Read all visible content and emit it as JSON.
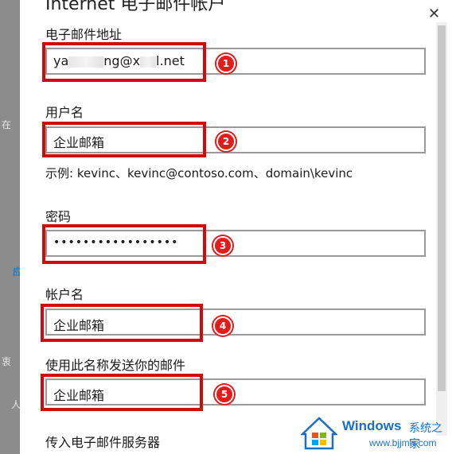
{
  "dialog": {
    "title": "Internet 电子邮件帐户",
    "close_glyph": "✕"
  },
  "background_fragments": {
    "frag1": "在",
    "frag2": "应",
    "frag3": "衷",
    "frag4": "人"
  },
  "form": {
    "email_label": "电子邮件地址",
    "email_value_start": "ya",
    "email_value_end": "ng@x",
    "email_value_tail": "l.net",
    "username_label": "用户名",
    "username_value": "企业邮箱",
    "username_hint": "示例: kevinc、kevinc@contoso.com、domain\\kevinc",
    "password_label": "密码",
    "password_value": "•••••••••••••••••",
    "account_name_label": "帐户名",
    "account_name_value": "企业邮箱",
    "send_name_label": "使用此名称发送你的邮件",
    "send_name_value": "企业邮箱",
    "incoming_server_label": "传入电子邮件服务器"
  },
  "steps": [
    "1",
    "2",
    "3",
    "4",
    "5"
  ],
  "watermark": {
    "brand": "Windows",
    "brand_cn": "系统之家",
    "url": "www.bjjmlv.com"
  },
  "colors": {
    "highlight": "#d20a0a",
    "badge": "#e21b1b",
    "watermark": "#1a6fc4"
  }
}
